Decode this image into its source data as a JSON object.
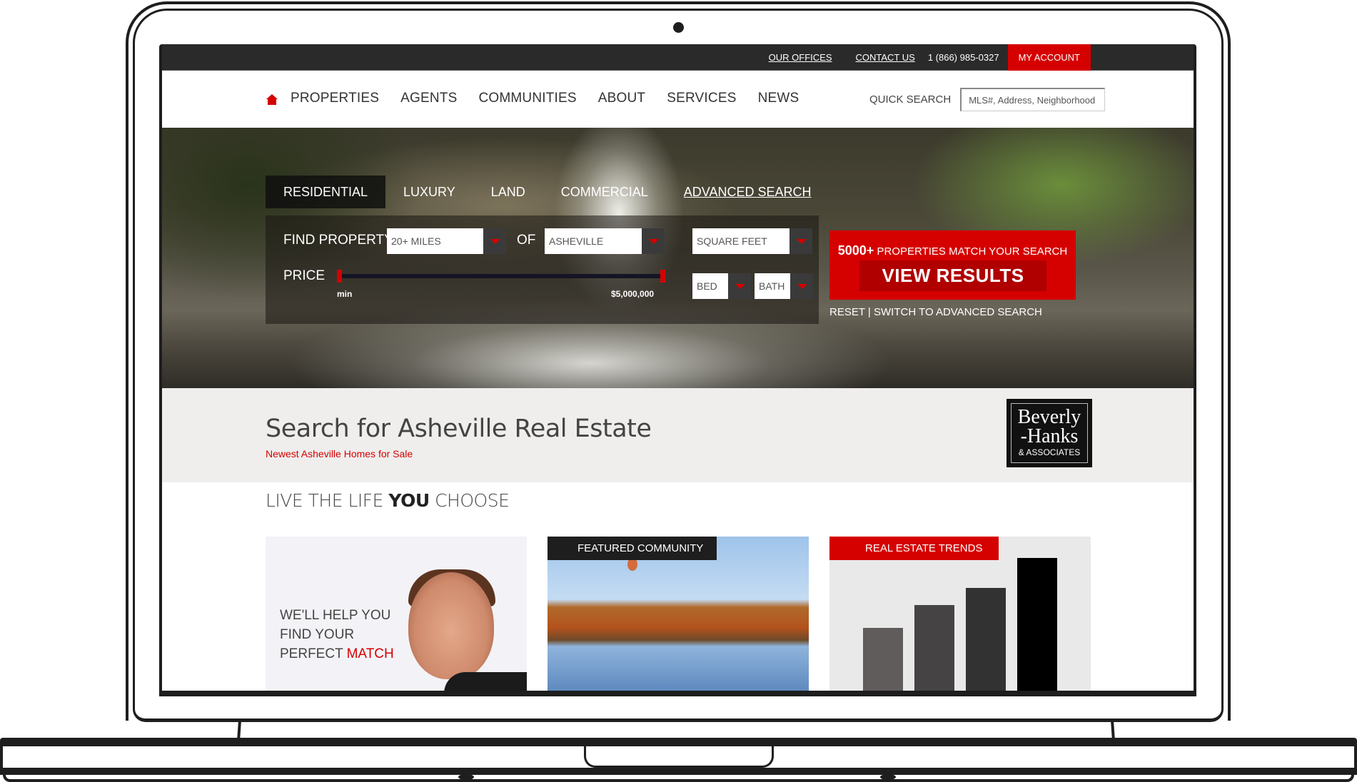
{
  "topbar": {
    "links": [
      "OUR OFFICES",
      "CONTACT US"
    ],
    "phone": "1 (866) 985-0327",
    "account": "MY ACCOUNT"
  },
  "nav": {
    "home_icon": "house-icon",
    "items": [
      "PROPERTIES",
      "AGENTS",
      "COMMUNITIES",
      "ABOUT",
      "SERVICES",
      "NEWS"
    ],
    "quick_search_label": "QUICK SEARCH",
    "quick_search_placeholder": "MLS#, Address, Neighborhood"
  },
  "hero": {
    "tabs": [
      "RESIDENTIAL",
      "LUXURY",
      "LAND",
      "COMMERCIAL",
      "ADVANCED SEARCH"
    ],
    "active_tab": "RESIDENTIAL",
    "find_label": "FIND PROPERTY",
    "distance": "20+ MILES",
    "of_label": "OF",
    "city": "ASHEVILLE",
    "sqft": "SQUARE FEET",
    "price_label": "PRICE",
    "price_min": "min",
    "price_max": "$5,000,000",
    "bed": "BED",
    "bath": "BATH",
    "match_count": "5000+",
    "match_text": "PROPERTIES MATCH YOUR SEARCH",
    "view_results": "VIEW RESULTS",
    "reset": "RESET",
    "separator": "|",
    "switch_advanced": "SWITCH TO ADVANCED SEARCH"
  },
  "band": {
    "title": "Search for Asheville Real Estate",
    "subtitle": "Newest Asheville Homes for Sale",
    "logo": {
      "line1": "Beverly",
      "line2": "-Hanks",
      "line3": "& ASSOCIATES"
    }
  },
  "life": {
    "pre": "LIVE THE LIFE ",
    "bold": "YOU",
    "post": " CHOOSE"
  },
  "cards": {
    "agent": {
      "line1": "WE'LL HELP YOU",
      "line2": "FIND YOUR",
      "line3_pre": "PERFECT ",
      "line3_red": "MATCH"
    },
    "community": {
      "tag": "FEATURED COMMUNITY"
    },
    "trends": {
      "tag": "REAL ESTATE TRENDS",
      "bars": [
        0.46,
        0.62,
        0.74,
        0.95
      ],
      "colors": [
        "#5f5c5b",
        "#454343",
        "#333232",
        "#000000"
      ]
    }
  },
  "colors": {
    "accent": "#d50000",
    "dark": "#2b2a2a"
  }
}
